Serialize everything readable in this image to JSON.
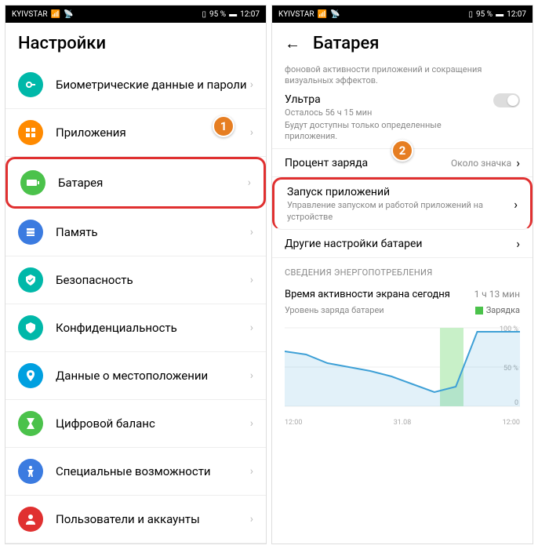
{
  "statusbar": {
    "carrier": "KYIVSTAR",
    "battery_pct": "95 %",
    "time": "12:07"
  },
  "left": {
    "title": "Настройки",
    "items": [
      {
        "label": "Биометрические данные и пароли",
        "color": "#00b8a9"
      },
      {
        "label": "Приложения",
        "color": "#ff8a00"
      },
      {
        "label": "Батарея",
        "color": "#4bc24b"
      },
      {
        "label": "Память",
        "color": "#3b7be0"
      },
      {
        "label": "Безопасность",
        "color": "#00b8a9"
      },
      {
        "label": "Конфиденциальность",
        "color": "#00b8a9"
      },
      {
        "label": "Данные о местоположении",
        "color": "#00a0e0"
      },
      {
        "label": "Цифровой баланс",
        "color": "#4bc24b"
      },
      {
        "label": "Специальные возможности",
        "color": "#3b7be0"
      },
      {
        "label": "Пользователи и аккаунты",
        "color": "#e03030"
      }
    ],
    "badge1": "1"
  },
  "right": {
    "title": "Батарея",
    "top_faded": "фоновой активности приложений и сокращения визуальных эффектов.",
    "ultra": {
      "title": "Ультра",
      "remaining": "Осталось 56 ч 15 мин",
      "sub": "Будут доступны только определенные приложения."
    },
    "charge_pct": {
      "title": "Процент заряда",
      "value": "Около значка"
    },
    "app_launch": {
      "title": "Запуск приложений",
      "sub": "Управление запуском и работой приложений на устройстве"
    },
    "other": {
      "title": "Другие настройки батареи"
    },
    "badge2": "2",
    "section": "СВЕДЕНИЯ ЭНЕРГОПОТРЕБЛЕНИЯ",
    "screen_today": {
      "title": "Время активности экрана сегодня",
      "value": "1 ч 13 мин"
    },
    "chart_label": "Уровень заряда батареи",
    "legend": "Зарядка"
  },
  "chart_data": {
    "type": "line",
    "title": "Уровень заряда батареи",
    "ylabel": "%",
    "ylim": [
      0,
      100
    ],
    "y_ticks": [
      "100 %",
      "50 %",
      "0"
    ],
    "x_ticks": [
      "12:00",
      "31.08",
      "12:00"
    ],
    "series": [
      {
        "name": "Уровень заряда",
        "values": [
          70,
          66,
          55,
          50,
          45,
          38,
          28,
          18,
          25,
          95,
          95,
          95
        ]
      }
    ],
    "charging_region": {
      "start_frac": 0.66,
      "end_frac": 0.76
    },
    "legend": [
      "Зарядка"
    ]
  }
}
